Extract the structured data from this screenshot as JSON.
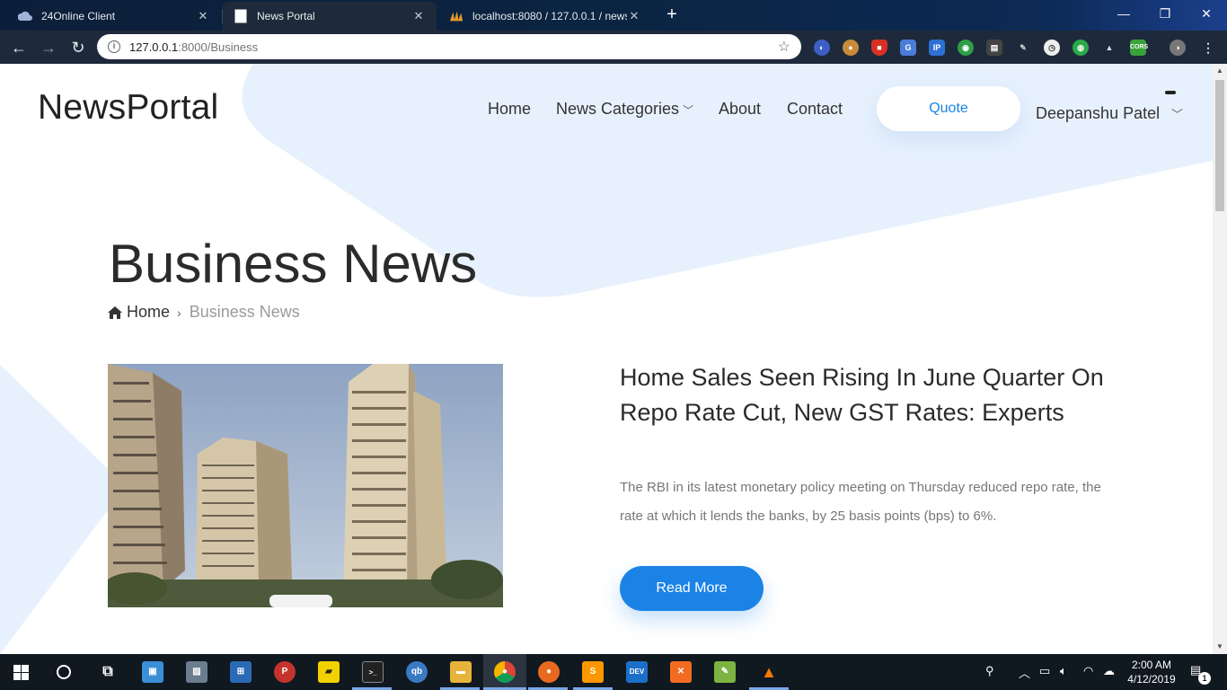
{
  "browser": {
    "tabs": [
      {
        "title": "24Online Client",
        "active": false
      },
      {
        "title": "News Portal",
        "active": true
      },
      {
        "title": "localhost:8080 / 127.0.0.1 / news",
        "active": false
      }
    ],
    "url_host": "127.0.0.1",
    "url_path": ":8000/Business"
  },
  "site": {
    "logo": "NewsPortal",
    "nav": {
      "home": "Home",
      "categories": "News Categories",
      "about": "About",
      "contact": "Contact"
    },
    "quote_button": "Quote",
    "user_name": "Deepanshu Patel"
  },
  "page": {
    "title": "Business News",
    "breadcrumb": {
      "home": "Home",
      "current": "Business News"
    },
    "article": {
      "headline": "Home Sales Seen Rising In June Quarter On Repo Rate Cut, New GST Rates: Experts",
      "excerpt": "The RBI in its latest monetary policy meeting on Thursday reduced repo rate, the rate at which it lends the banks, by 25 basis points (bps) to 6%.",
      "read_more": "Read More"
    }
  },
  "taskbar": {
    "time": "2:00 AM",
    "date": "4/12/2019",
    "notification_count": "1"
  },
  "colors": {
    "accent": "#1b83e6",
    "blob": "#e7f1fd"
  }
}
